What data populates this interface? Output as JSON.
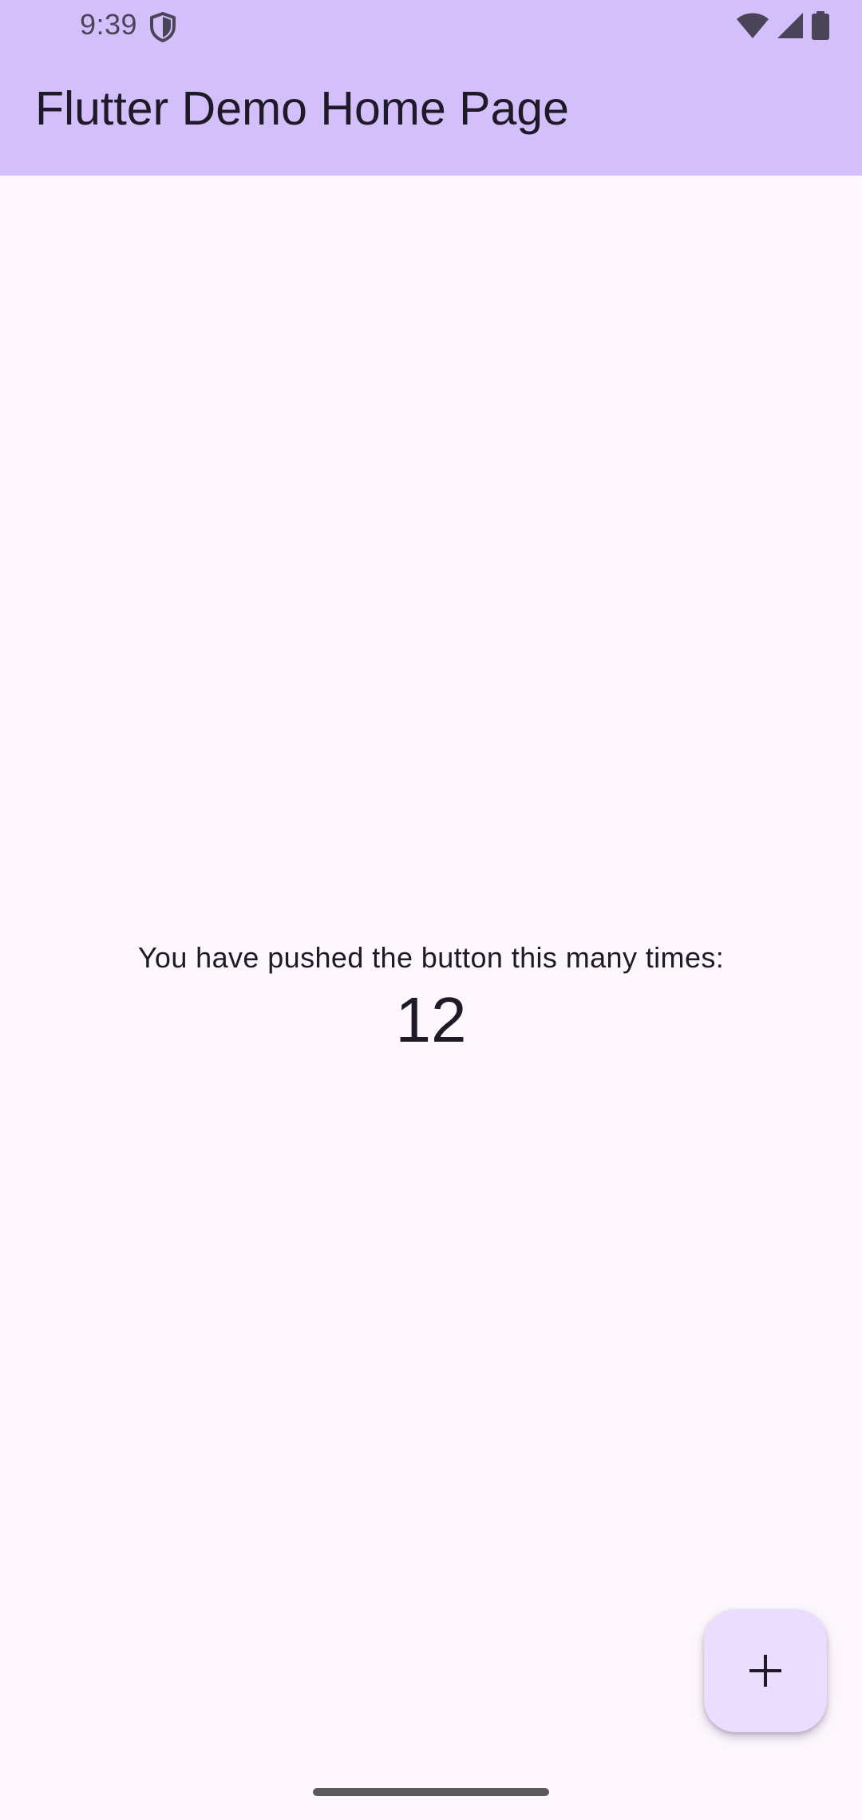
{
  "status_bar": {
    "time": "9:39",
    "icons": [
      "shield-icon",
      "wifi-icon",
      "cellular-signal-icon",
      "battery-icon"
    ]
  },
  "app_bar": {
    "title": "Flutter Demo Home Page",
    "background_color": "#d3bffa"
  },
  "body": {
    "caption": "You have pushed the button this many times:",
    "counter": "12",
    "background_color": "#fdf7fd"
  },
  "fab": {
    "icon": "add-icon",
    "background_color": "#ebddfd"
  },
  "nav": {
    "gesture_handle": "gesture-navigation-handle"
  }
}
